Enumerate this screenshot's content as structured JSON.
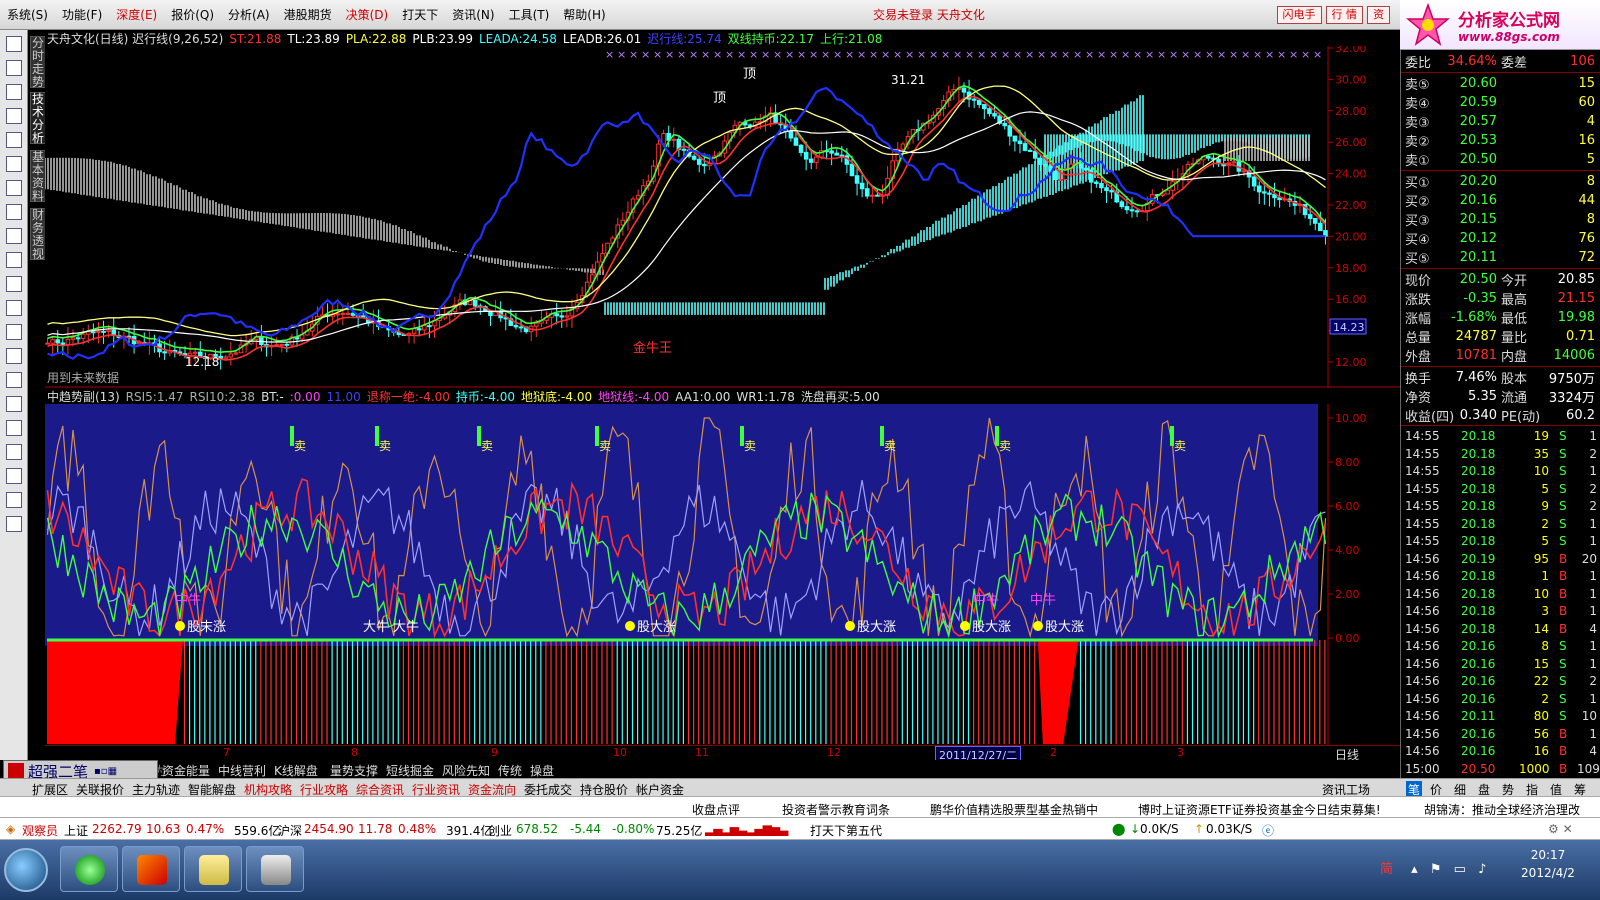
{
  "menu": {
    "items": [
      "系统(S)",
      "功能(F)",
      "深度(E)",
      "报价(Q)",
      "分析(A)",
      "港股期货",
      "决策(D)",
      "打天下",
      "资讯(N)",
      "工具(T)",
      "帮助(H)"
    ],
    "red_items": [
      2,
      6
    ],
    "notice": "交易未登录 天舟文化",
    "right_buttons": [
      "闪电手",
      "行 情",
      "资"
    ]
  },
  "logo": {
    "line1": "分析家公式网",
    "line2": "www.88gs.com"
  },
  "left_tabs": [
    "分时走势",
    "技术分析",
    "基本资料",
    "财务透视"
  ],
  "left_icons": [
    "grid-icon",
    "list-icon",
    "trend-icon",
    "kline-icon",
    "box-icon",
    "f10-icon",
    "report-icon",
    "f12-icon",
    "f6-icon",
    "search-icon",
    "etf-icon",
    "wave-icon",
    "rsi-icon",
    "table-icon",
    "dollar-icon",
    "note-icon",
    "exit-icon",
    "pen-icon",
    "move-icon",
    "up-arrow-icon",
    "down-arrow-icon"
  ],
  "main_header": [
    {
      "text": "天舟文化(日线) 迟行线(9,26,52)",
      "color": "#dddddd"
    },
    {
      "text": "ST:21.88",
      "color": "#ff3030"
    },
    {
      "text": "TL:23.89",
      "color": "#ffffff"
    },
    {
      "text": "PLA:22.88",
      "color": "#ffff40"
    },
    {
      "text": "PLB:23.99",
      "color": "#ffffff"
    },
    {
      "text": "LEADA:24.58",
      "color": "#40ffff"
    },
    {
      "text": "LEADB:26.01",
      "color": "#ffffff"
    },
    {
      "text": "迟行线:25.74",
      "color": "#4040ff"
    },
    {
      "text": "双线持币:22.17",
      "color": "#40ff40"
    },
    {
      "text": "上行:21.08",
      "color": "#40ff40"
    }
  ],
  "main_note": "用到未来数据",
  "main_markers": {
    "top1": "顶",
    "top2": "顶",
    "high_label": "31.21",
    "low_label": "12.18",
    "king_label": "金牛王"
  },
  "sub_header": [
    {
      "text": "中趋势副(13)",
      "color": "#dddddd"
    },
    {
      "text": "RSI5:1.47",
      "color": "#aaaaaa"
    },
    {
      "text": "RSI10:2.38",
      "color": "#aaaaaa"
    },
    {
      "text": "BT:-",
      "color": "#dddddd"
    },
    {
      "text": ":0.00",
      "color": "#ff40ff"
    },
    {
      "text": "11.00",
      "color": "#4040ff"
    },
    {
      "text": "退称一绝:-4.00",
      "color": "#ff3030"
    },
    {
      "text": "持币:-4.00",
      "color": "#40ffff"
    },
    {
      "text": "地狱底:-4.00",
      "color": "#ffff40"
    },
    {
      "text": "地狱线:-4.00",
      "color": "#ff40ff"
    },
    {
      "text": "AA1:0.00",
      "color": "#dddddd"
    },
    {
      "text": "WR1:1.78",
      "color": "#dddddd"
    },
    {
      "text": "洗盘再买:5.00",
      "color": "#dddddd"
    }
  ],
  "sub_labels": {
    "sell": "卖",
    "mid_bull": "中牛",
    "rise": "股大涨",
    "bull": "大牛",
    "rise_a": "股末涨"
  },
  "price_axis": [
    "32.00",
    "30.00",
    "28.00",
    "26.00",
    "24.00",
    "22.00",
    "20.00",
    "18.00",
    "16.00",
    "14.00",
    "12.00"
  ],
  "price_badge": "14.23",
  "sub_axis": [
    "10.00",
    "8.00",
    "6.00",
    "4.00",
    "2.00",
    "0.00"
  ],
  "x_axis": {
    "labels": [
      "7",
      "8",
      "9",
      "10",
      "11",
      "12",
      "2",
      "3"
    ],
    "date_badge": "2011/12/27/二",
    "period": "日线"
  },
  "quote": {
    "ratio": {
      "label": "委比",
      "value": "34.64%",
      "label2": "委差",
      "value2": "106"
    },
    "sells": [
      {
        "label": "卖⑤",
        "price": "20.60",
        "vol": "15"
      },
      {
        "label": "卖④",
        "price": "20.59",
        "vol": "60"
      },
      {
        "label": "卖③",
        "price": "20.57",
        "vol": "4"
      },
      {
        "label": "卖②",
        "price": "20.53",
        "vol": "16"
      },
      {
        "label": "卖①",
        "price": "20.50",
        "vol": "5"
      }
    ],
    "buys": [
      {
        "label": "买①",
        "price": "20.20",
        "vol": "8"
      },
      {
        "label": "买②",
        "price": "20.16",
        "vol": "44"
      },
      {
        "label": "买③",
        "price": "20.15",
        "vol": "8"
      },
      {
        "label": "买④",
        "price": "20.12",
        "vol": "76"
      },
      {
        "label": "买⑤",
        "price": "20.11",
        "vol": "72"
      }
    ],
    "stats": [
      {
        "l1": "现价",
        "v1": "20.50",
        "c1": "#40ff40",
        "l2": "今开",
        "v2": "20.85",
        "c2": "#ffffff"
      },
      {
        "l1": "涨跌",
        "v1": "-0.35",
        "c1": "#40ff40",
        "l2": "最高",
        "v2": "21.15",
        "c2": "#ff3030"
      },
      {
        "l1": "涨幅",
        "v1": "-1.68%",
        "c1": "#40ff40",
        "l2": "最低",
        "v2": "19.98",
        "c2": "#40ff40"
      },
      {
        "l1": "总量",
        "v1": "24787",
        "c1": "#ffff40",
        "l2": "量比",
        "v2": "0.71",
        "c2": "#ffff40"
      },
      {
        "l1": "外盘",
        "v1": "10781",
        "c1": "#ff3030",
        "l2": "内盘",
        "v2": "14006",
        "c2": "#40ff40"
      }
    ],
    "stats2": [
      {
        "l1": "换手",
        "v1": "7.46%",
        "l2": "股本",
        "v2": "9750万"
      },
      {
        "l1": "净资",
        "v1": "5.35",
        "l2": "流通",
        "v2": "3324万"
      },
      {
        "l1": "收益(四)",
        "v1": "0.340",
        "l2": "PE(动)",
        "v2": "60.2"
      }
    ],
    "ticks": [
      {
        "t": "14:55",
        "p": "20.18",
        "v": "19",
        "bs": "S",
        "n": "1"
      },
      {
        "t": "14:55",
        "p": "20.18",
        "v": "35",
        "bs": "S",
        "n": "2"
      },
      {
        "t": "14:55",
        "p": "20.18",
        "v": "10",
        "bs": "S",
        "n": "1"
      },
      {
        "t": "14:55",
        "p": "20.18",
        "v": "5",
        "bs": "S",
        "n": "2"
      },
      {
        "t": "14:55",
        "p": "20.18",
        "v": "9",
        "bs": "S",
        "n": "2"
      },
      {
        "t": "14:55",
        "p": "20.18",
        "v": "2",
        "bs": "S",
        "n": "1"
      },
      {
        "t": "14:55",
        "p": "20.18",
        "v": "5",
        "bs": "S",
        "n": "1"
      },
      {
        "t": "14:56",
        "p": "20.19",
        "v": "95",
        "bs": "B",
        "n": "20"
      },
      {
        "t": "14:56",
        "p": "20.18",
        "v": "1",
        "bs": "B",
        "n": "1"
      },
      {
        "t": "14:56",
        "p": "20.18",
        "v": "10",
        "bs": "B",
        "n": "1"
      },
      {
        "t": "14:56",
        "p": "20.18",
        "v": "3",
        "bs": "B",
        "n": "1"
      },
      {
        "t": "14:56",
        "p": "20.18",
        "v": "14",
        "bs": "B",
        "n": "4"
      },
      {
        "t": "14:56",
        "p": "20.16",
        "v": "8",
        "bs": "S",
        "n": "1"
      },
      {
        "t": "14:56",
        "p": "20.16",
        "v": "15",
        "bs": "S",
        "n": "1"
      },
      {
        "t": "14:56",
        "p": "20.16",
        "v": "22",
        "bs": "S",
        "n": "2"
      },
      {
        "t": "14:56",
        "p": "20.16",
        "v": "2",
        "bs": "S",
        "n": "1"
      },
      {
        "t": "14:56",
        "p": "20.11",
        "v": "80",
        "bs": "S",
        "n": "10"
      },
      {
        "t": "14:56",
        "p": "20.16",
        "v": "56",
        "bs": "B",
        "n": "1"
      },
      {
        "t": "14:56",
        "p": "20.16",
        "v": "16",
        "bs": "B",
        "n": "4"
      },
      {
        "t": "15:00",
        "p": "20.50",
        "v": "1000",
        "bs": "B",
        "n": "109"
      }
    ]
  },
  "widget": {
    "title": "超强二笔"
  },
  "tabs1": [
    "指标",
    "模版",
    "管理",
    "另存为",
    "资金能量",
    "中线营利",
    "K线解盘",
    "量势支撑",
    "短线掘金",
    "风险先知",
    "传统",
    "操盘"
  ],
  "tabs2": [
    {
      "label": "扩展区",
      "red": false
    },
    {
      "label": "关联报价",
      "red": false
    },
    {
      "label": "主力轨迹",
      "red": false
    },
    {
      "label": "智能解盘",
      "red": false
    },
    {
      "label": "机构攻略",
      "red": true
    },
    {
      "label": "行业攻略",
      "red": true
    },
    {
      "label": "综合资讯",
      "red": true
    },
    {
      "label": "行业资讯",
      "red": true
    },
    {
      "label": "资金流向",
      "red": true
    },
    {
      "label": "委托成交",
      "red": false
    },
    {
      "label": "持仓股价",
      "red": false
    },
    {
      "label": "帐户资金",
      "red": false
    }
  ],
  "rtabs": {
    "label": "资讯工场",
    "items": [
      "笔",
      "价",
      "细",
      "盘",
      "势",
      "指",
      "值",
      "筹"
    ]
  },
  "news": [
    "收盘点评",
    "投资者警示教育词条",
    "鹏华价值精选股票型基金热销中",
    "博时上证资源ETF证券投资基金今日结束募集!",
    "胡锦涛：推动全球经济治理改"
  ],
  "indexbar": {
    "watch": "观察员",
    "sh": {
      "name": "上证",
      "value": "2262.79",
      "chg": "10.63",
      "pct": "0.47%",
      "amt": "559.6亿"
    },
    "sz": {
      "name": "沪深",
      "value": "2454.90",
      "chg": "11.78",
      "pct": "0.48%",
      "amt": "391.4亿"
    },
    "cy": {
      "name": "创业",
      "value": "678.52",
      "chg": "-5.44",
      "pct": "-0.80%",
      "amt": "75.25亿"
    },
    "slogan": "打天下第五代",
    "down_speed": "0.0K/S",
    "up_speed": "0.03K/S"
  },
  "taskbar": {
    "time": "20:17",
    "date": "2012/4/2",
    "ime": "简"
  }
}
